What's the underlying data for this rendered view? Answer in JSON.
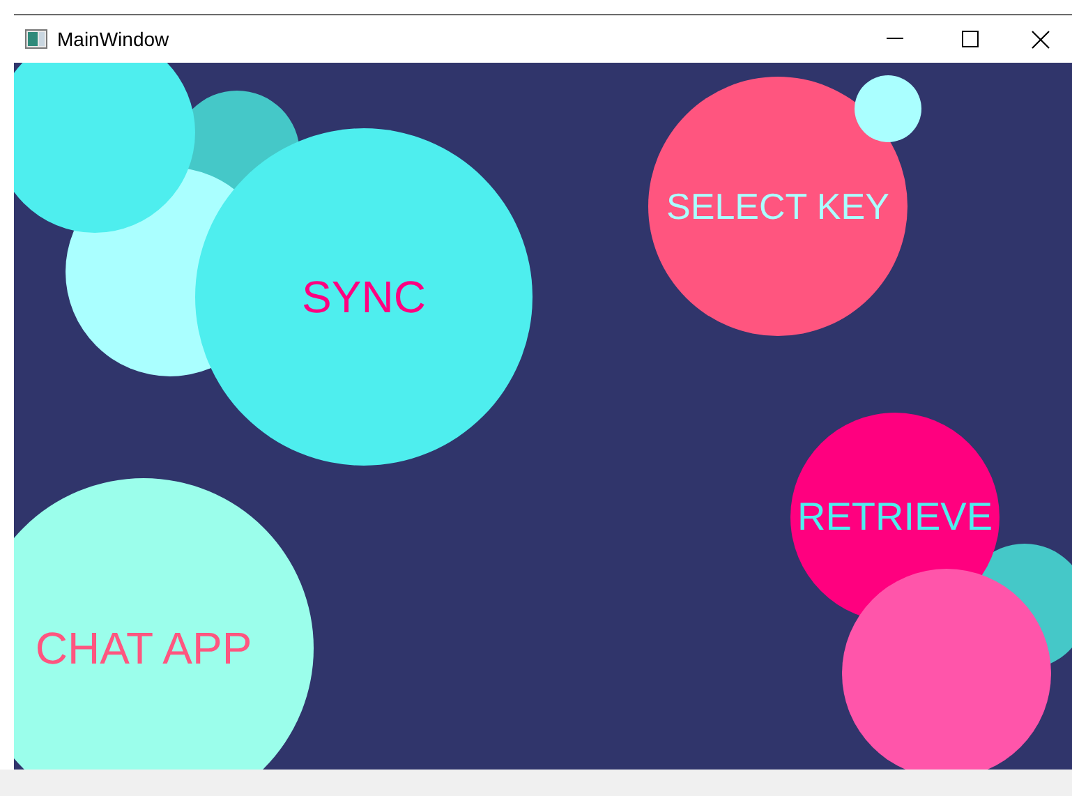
{
  "window": {
    "title": "MainWindow"
  },
  "bubbles": [
    {
      "kind": "bubble",
      "color": "#45c8c8"
    },
    {
      "kind": "bubble",
      "color": "#aaffff"
    },
    {
      "kind": "bubble",
      "color": "#4eeeee"
    },
    {
      "kind": "button",
      "label": "SYNC",
      "color": "#4eeeee"
    },
    {
      "kind": "button",
      "label": "SELECT KEY",
      "color": "#ff557f"
    },
    {
      "kind": "bubble",
      "color": "#aaffff"
    },
    {
      "kind": "bubble",
      "color": "#45c8c8"
    },
    {
      "kind": "button",
      "label": "RETRIEVE",
      "color": "#ff007f"
    },
    {
      "kind": "bubble",
      "color": "#ff55aa"
    },
    {
      "kind": "button",
      "label": "CHAT APP",
      "color": "#9bfeeb"
    }
  ]
}
